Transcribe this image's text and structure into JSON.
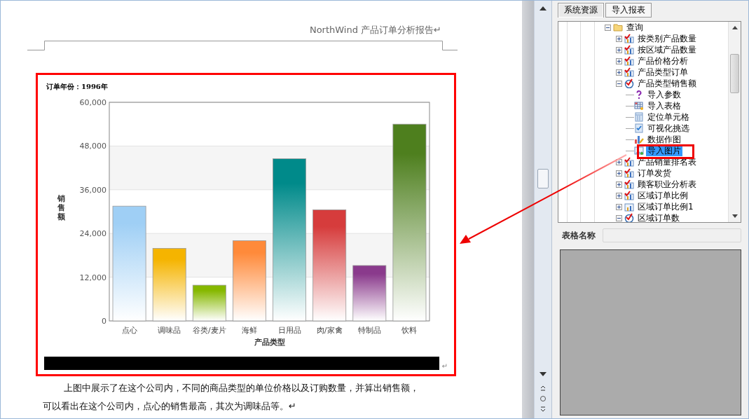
{
  "document": {
    "header": "NorthWind 产品订单分析报告↵",
    "figure": {
      "title": "订单年份：1996年",
      "chart_data": {
        "type": "bar",
        "grid": true,
        "xlabel": "产品类型",
        "ylabel": "销售额",
        "categories": [
          "点心",
          "调味品",
          "谷类/麦片",
          "海鲜",
          "日用品",
          "肉/家禽",
          "特制品",
          "饮料"
        ],
        "series": [
          {
            "values": [
              31500,
              19900,
              9800,
              22000,
              44500,
              30500,
              15200,
              54000
            ]
          }
        ],
        "ylim": [
          0,
          60000
        ],
        "yticks": [
          {
            "value": 0,
            "label": "0"
          },
          {
            "value": 12000,
            "label": "12,000"
          },
          {
            "value": 24000,
            "label": "24,000"
          },
          {
            "value": 36000,
            "label": "36,000"
          },
          {
            "value": 48000,
            "label": "48,000"
          },
          {
            "value": 60000,
            "label": "60,000"
          }
        ]
      },
      "end_mark": "↵"
    },
    "lines": [
      "上图中展示了在这个公司内，不同的商品类型的单位价格以及订购数量，并算出销售额，",
      "可以看出在这个公司内，点心的销售最高，其次为调味品等。↵"
    ]
  },
  "panel": {
    "tabs": [
      {
        "label": "系统资源",
        "selected": true
      },
      {
        "label": "导入报表",
        "selected": false
      }
    ],
    "tree": [
      {
        "label": "查询",
        "kind": "folder",
        "expanded": true,
        "selected": false,
        "children": [
          {
            "label": "按类别产品数量",
            "kind": "report",
            "expanded": false,
            "selected": false
          },
          {
            "label": "按区域产品数量",
            "kind": "report",
            "expanded": false,
            "selected": false
          },
          {
            "label": "产品价格分析",
            "kind": "report",
            "expanded": false,
            "selected": false
          },
          {
            "label": "产品类型订单",
            "kind": "report",
            "expanded": false,
            "selected": false
          },
          {
            "label": "产品类型销售额",
            "kind": "dial",
            "expanded": true,
            "selected": false,
            "children": [
              {
                "label": "导入参数",
                "kind": "question",
                "selected": false
              },
              {
                "label": "导入表格",
                "kind": "table",
                "selected": false
              },
              {
                "label": "定位单元格",
                "kind": "cell",
                "selected": false
              },
              {
                "label": "可视化挑选",
                "kind": "filter",
                "selected": false
              },
              {
                "label": "数据作图",
                "kind": "plot",
                "selected": false
              },
              {
                "label": "导入图片",
                "kind": "image",
                "selected": true
              }
            ]
          },
          {
            "label": "产品销量排名表",
            "kind": "report",
            "expanded": false,
            "selected": false
          },
          {
            "label": "订单发货",
            "kind": "report",
            "expanded": false,
            "selected": false
          },
          {
            "label": "顾客职业分析表",
            "kind": "report",
            "expanded": false,
            "selected": false
          },
          {
            "label": "区域订单比例",
            "kind": "report",
            "expanded": false,
            "selected": false
          },
          {
            "label": "区域订单比例1",
            "kind": "chart",
            "expanded": false,
            "selected": false
          },
          {
            "label": "区域订单数",
            "kind": "dial",
            "expanded": true,
            "selected": false
          }
        ]
      }
    ],
    "name_field": {
      "label": "表格名称"
    }
  }
}
